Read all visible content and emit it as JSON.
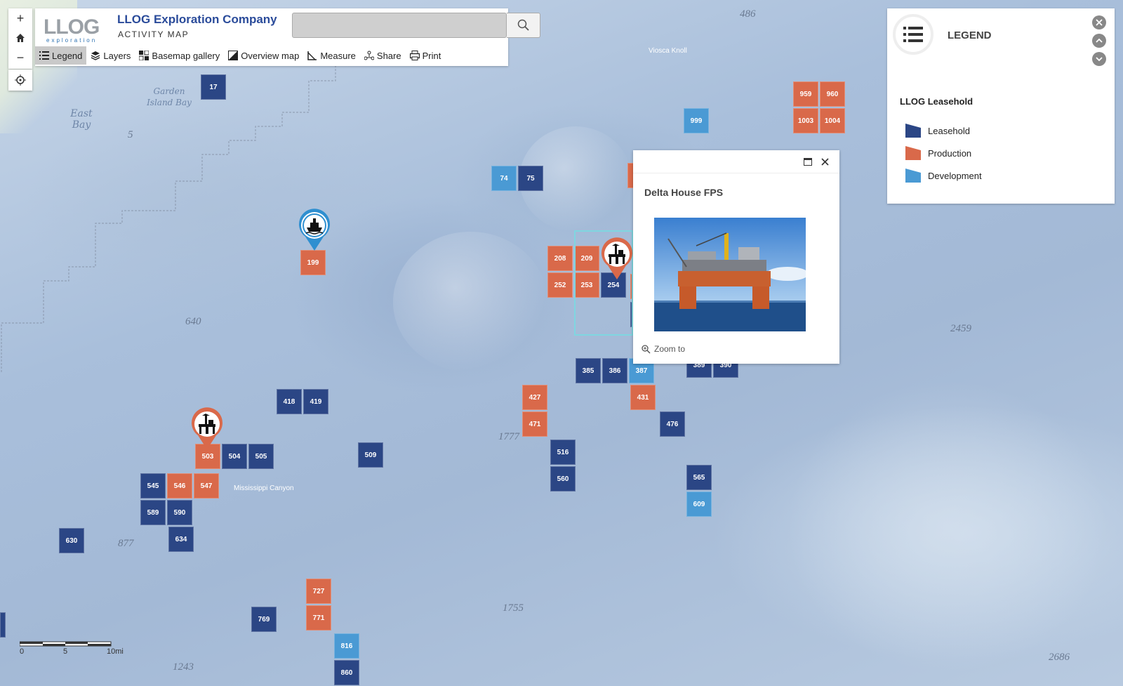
{
  "header": {
    "logo_text": "LLOG",
    "logo_sub": "exploration",
    "title": "LLOG Exploration Company",
    "subtitle": "ACTIVITY MAP",
    "search_value": ""
  },
  "toolbar": {
    "legend": "Legend",
    "layers": "Layers",
    "basemap": "Basemap gallery",
    "overview": "Overview map",
    "measure": "Measure",
    "share": "Share",
    "print": "Print"
  },
  "zoom": {
    "plus": "+",
    "minus": "−"
  },
  "map_labels": {
    "garden_island_bay": "Garden Island Bay",
    "east_bay": "East Bay",
    "viosca_knoll": "Viosca Knoll",
    "mississippi_canyon": "Mississippi Canyon",
    "depths": [
      "486",
      "5",
      "640",
      "877",
      "1243",
      "1777",
      "1755",
      "2459",
      "2686"
    ]
  },
  "blocks": [
    {
      "id": "17",
      "type": "leasehold"
    },
    {
      "id": "959",
      "type": "production"
    },
    {
      "id": "960",
      "type": "production"
    },
    {
      "id": "1003",
      "type": "production"
    },
    {
      "id": "1004",
      "type": "production"
    },
    {
      "id": "999",
      "type": "development"
    },
    {
      "id": "74",
      "type": "development"
    },
    {
      "id": "75",
      "type": "leasehold"
    },
    {
      "id": "199",
      "type": "production"
    },
    {
      "id": "208",
      "type": "production"
    },
    {
      "id": "209",
      "type": "production"
    },
    {
      "id": "252",
      "type": "production"
    },
    {
      "id": "253",
      "type": "production"
    },
    {
      "id": "254",
      "type": "leasehold"
    },
    {
      "id": "385",
      "type": "leasehold"
    },
    {
      "id": "386",
      "type": "leasehold"
    },
    {
      "id": "387",
      "type": "development"
    },
    {
      "id": "389",
      "type": "leasehold"
    },
    {
      "id": "390",
      "type": "leasehold"
    },
    {
      "id": "431",
      "type": "production"
    },
    {
      "id": "476",
      "type": "leasehold"
    },
    {
      "id": "418",
      "type": "leasehold"
    },
    {
      "id": "419",
      "type": "leasehold"
    },
    {
      "id": "427",
      "type": "production"
    },
    {
      "id": "471",
      "type": "production"
    },
    {
      "id": "509",
      "type": "leasehold"
    },
    {
      "id": "516",
      "type": "leasehold"
    },
    {
      "id": "560",
      "type": "leasehold"
    },
    {
      "id": "565",
      "type": "leasehold"
    },
    {
      "id": "609",
      "type": "development"
    },
    {
      "id": "503",
      "type": "production"
    },
    {
      "id": "504",
      "type": "leasehold"
    },
    {
      "id": "505",
      "type": "leasehold"
    },
    {
      "id": "545",
      "type": "leasehold"
    },
    {
      "id": "546",
      "type": "production"
    },
    {
      "id": "547",
      "type": "production"
    },
    {
      "id": "589",
      "type": "leasehold"
    },
    {
      "id": "590",
      "type": "leasehold"
    },
    {
      "id": "634",
      "type": "leasehold"
    },
    {
      "id": "630",
      "type": "leasehold"
    },
    {
      "id": "727",
      "type": "production"
    },
    {
      "id": "771",
      "type": "production"
    },
    {
      "id": "769",
      "type": "leasehold"
    },
    {
      "id": "816",
      "type": "development"
    },
    {
      "id": "860",
      "type": "leasehold"
    }
  ],
  "popup": {
    "title": "Delta House FPS",
    "zoom_to": "Zoom to"
  },
  "legend": {
    "title": "LEGEND",
    "layer_title": "LLOG Leasehold",
    "items": [
      {
        "label": "Leasehold",
        "color": "#2b4685"
      },
      {
        "label": "Production",
        "color": "#d9694a"
      },
      {
        "label": "Development",
        "color": "#4a9ad4"
      }
    ]
  },
  "scale": {
    "labels": [
      "0",
      "5",
      "10mi"
    ]
  },
  "colors": {
    "leasehold": "#2b4685",
    "production": "#d9694a",
    "development": "#4a9ad4",
    "brand": "#2a4b9a"
  }
}
